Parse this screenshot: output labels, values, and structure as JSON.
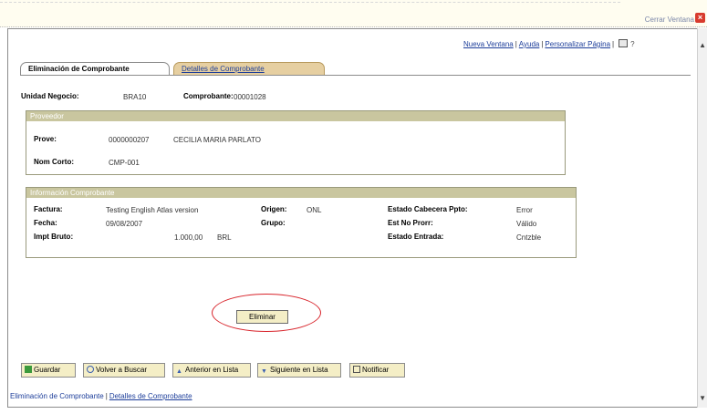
{
  "window": {
    "close_label": "Cerrar Ventana"
  },
  "links": {
    "new_window": "Nueva Ventana",
    "help": "Ayuda",
    "personalize": "Personalizar Página"
  },
  "tabs": [
    {
      "label": "Eliminación de Comprobante",
      "active": true
    },
    {
      "label": "Detalles de Comprobante",
      "active": false
    }
  ],
  "header": {
    "unit_label": "Unidad Negocio:",
    "unit_value": "BRA10",
    "voucher_label": "Comprobante:",
    "voucher_value": "00001028"
  },
  "provider": {
    "title": "Proveedor",
    "prove_label": "Prove:",
    "prove_id": "0000000207",
    "prove_name": "CECILIA MARIA PARLATO",
    "short_label": "Nom Corto:",
    "short_value": "CMP-001"
  },
  "voucher_info": {
    "title": "Información Comprobante",
    "invoice_label": "Factura:",
    "invoice_value": "Testing English Atlas version",
    "date_label": "Fecha:",
    "date_value": "09/08/2007",
    "gross_label": "Impt Bruto:",
    "gross_value": "1.000,00",
    "currency": "BRL",
    "origin_label": "Origen:",
    "origin_value": "ONL",
    "group_label": "Grupo:",
    "budget_header_label": "Estado Cabecera Ppto:",
    "budget_header_value": "Error",
    "no_prorate_label": "Est No Prorr:",
    "no_prorate_value": "Válido",
    "entry_status_label": "Estado Entrada:",
    "entry_status_value": "Cntzble"
  },
  "actions": {
    "delete": "Eliminar"
  },
  "toolbar": {
    "save": "Guardar",
    "back_search": "Volver a Buscar",
    "prev": "Anterior en Lista",
    "next": "Siguiente en Lista",
    "notify": "Notificar"
  },
  "footer": {
    "current": "Eliminación de Comprobante",
    "details": "Detalles de Comprobante"
  },
  "colors": {
    "tab_inactive": "#e6cfa1",
    "group_header": "#c9c69f",
    "button_bg": "#f4eec6",
    "highlight": "#d8242b",
    "link": "#1d3e9a"
  }
}
